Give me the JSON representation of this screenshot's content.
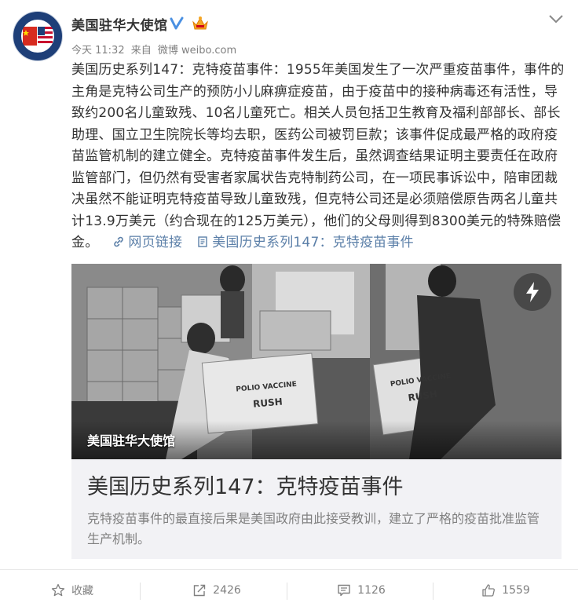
{
  "post": {
    "author": "美国驻华大使馆",
    "time": "今天 11:32",
    "source_prefix": "来自",
    "source": "微博 weibo.com",
    "text": "美国历史系列147：克特疫苗事件：1955年美国发生了一次严重疫苗事件，事件的主角是克特公司生产的预防小儿麻痹症疫苗，由于疫苗中的接种病毒还有活性，导致约200名儿童致残、10名儿童死亡。相关人员包括卫生教育及福利部部长、部长助理、国立卫生院院长等均去职，医药公司被罚巨款；该事件促成最严格的政府疫苗监管机制的建立健全。克特疫苗事件发生后，虽然调查结果证明主要责任在政府监管部门，但仍然有受害者家属状告克特制药公司，在一项民事诉讼中，陪审团裁决虽然不能证明克特疫苗导致儿童致残，但克特公司还是必须赔偿原告两名儿童共计13.9万美元（约合现在的125万美元），他们的父母则得到8300美元的特殊赔偿金。",
    "web_link_label": "网页链接",
    "article_link_label": "美国历史系列147：克特疫苗事件"
  },
  "card": {
    "watermark": "美国驻华大使馆",
    "title": "美国历史系列147：克特疫苗事件",
    "description": "克特疫苗事件的最直接后果是美国政府由此接受教训，建立了严格的疫苗批准监管生产机制。",
    "box_label_1": "POLIO VACCINE",
    "box_label_2": "RUSH"
  },
  "actions": {
    "favorite_label": "收藏",
    "repost_count": "2426",
    "comment_count": "1126",
    "like_count": "1559"
  },
  "colors": {
    "link": "#5b7fa8",
    "verified": "#4a90e2",
    "text": "#333333",
    "muted": "#808080"
  },
  "icons": [
    "verified-icon",
    "vip-crown-icon",
    "chevron-down-icon",
    "link-icon",
    "article-icon",
    "lightning-icon",
    "star-icon",
    "repost-icon",
    "comment-icon",
    "thumbs-up-icon"
  ]
}
